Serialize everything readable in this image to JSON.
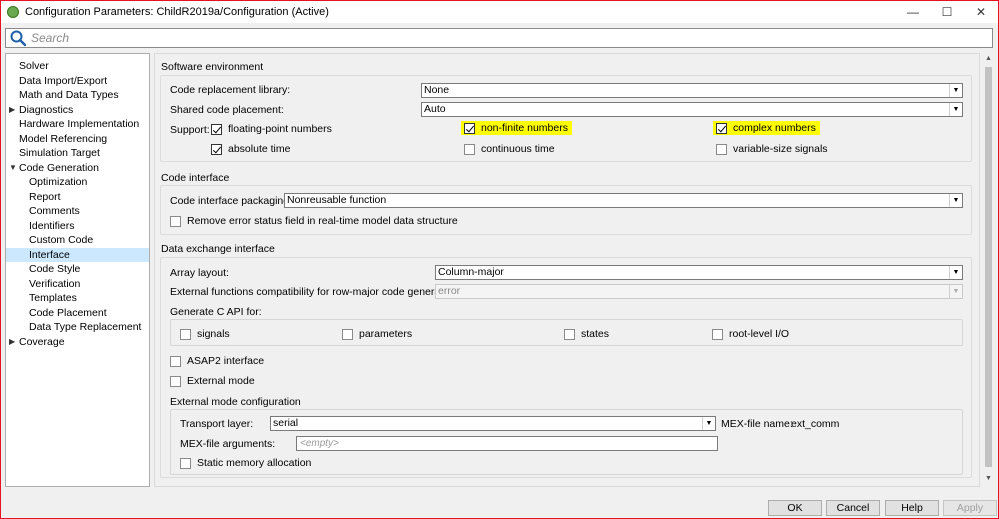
{
  "window": {
    "title": "Configuration Parameters: ChildR2019a/Configuration (Active)",
    "controls": {
      "minimize": "—",
      "maximize": "☐",
      "close": "✕"
    }
  },
  "search": {
    "placeholder": "Search"
  },
  "nav": {
    "items": [
      {
        "label": "Solver",
        "expandable": false,
        "child": false,
        "selected": false
      },
      {
        "label": "Data Import/Export",
        "expandable": false,
        "child": false,
        "selected": false
      },
      {
        "label": "Math and Data Types",
        "expandable": false,
        "child": false,
        "selected": false
      },
      {
        "label": "Diagnostics",
        "expandable": true,
        "expanded": false,
        "child": false,
        "selected": false
      },
      {
        "label": "Hardware Implementation",
        "expandable": false,
        "child": false,
        "selected": false
      },
      {
        "label": "Model Referencing",
        "expandable": false,
        "child": false,
        "selected": false
      },
      {
        "label": "Simulation Target",
        "expandable": false,
        "child": false,
        "selected": false
      },
      {
        "label": "Code Generation",
        "expandable": true,
        "expanded": true,
        "child": false,
        "selected": false
      },
      {
        "label": "Optimization",
        "expandable": false,
        "child": true,
        "selected": false
      },
      {
        "label": "Report",
        "expandable": false,
        "child": true,
        "selected": false
      },
      {
        "label": "Comments",
        "expandable": false,
        "child": true,
        "selected": false
      },
      {
        "label": "Identifiers",
        "expandable": false,
        "child": true,
        "selected": false
      },
      {
        "label": "Custom Code",
        "expandable": false,
        "child": true,
        "selected": false
      },
      {
        "label": "Interface",
        "expandable": false,
        "child": true,
        "selected": true
      },
      {
        "label": "Code Style",
        "expandable": false,
        "child": true,
        "selected": false
      },
      {
        "label": "Verification",
        "expandable": false,
        "child": true,
        "selected": false
      },
      {
        "label": "Templates",
        "expandable": false,
        "child": true,
        "selected": false
      },
      {
        "label": "Code Placement",
        "expandable": false,
        "child": true,
        "selected": false
      },
      {
        "label": "Data Type Replacement",
        "expandable": false,
        "child": true,
        "selected": false
      },
      {
        "label": "Coverage",
        "expandable": true,
        "expanded": false,
        "child": false,
        "selected": false
      }
    ]
  },
  "software_env": {
    "title": "Software environment",
    "code_replacement_label": "Code replacement library:",
    "code_replacement_value": "None",
    "shared_code_label": "Shared code placement:",
    "shared_code_value": "Auto",
    "support_label": "Support:",
    "floating_point": {
      "label": "floating-point numbers",
      "checked": true
    },
    "non_finite": {
      "label": "non-finite numbers",
      "checked": true,
      "highlighted": true
    },
    "complex": {
      "label": "complex numbers",
      "checked": true,
      "highlighted": true
    },
    "absolute_time": {
      "label": "absolute time",
      "checked": true
    },
    "continuous_time": {
      "label": "continuous time",
      "checked": false
    },
    "variable_size": {
      "label": "variable-size signals",
      "checked": false
    }
  },
  "code_interface": {
    "title": "Code interface",
    "packaging_label": "Code interface packaging:",
    "packaging_value": "Nonreusable function",
    "remove_error_status": {
      "label": "Remove error status field in real-time model data structure",
      "checked": false
    }
  },
  "data_exchange": {
    "title": "Data exchange interface",
    "array_layout_label": "Array layout:",
    "array_layout_value": "Column-major",
    "ext_functions_label": "External functions compatibility for row-major code generation:",
    "ext_functions_value": "error",
    "c_api_label": "Generate C API for:",
    "c_api": [
      {
        "label": "signals",
        "checked": false
      },
      {
        "label": "parameters",
        "checked": false
      },
      {
        "label": "states",
        "checked": false
      },
      {
        "label": "root-level I/O",
        "checked": false
      }
    ],
    "asap2": {
      "label": "ASAP2 interface",
      "checked": false
    },
    "external_mode": {
      "label": "External mode",
      "checked": false
    },
    "ext_mode_config_title": "External mode configuration",
    "transport_label": "Transport layer:",
    "transport_value": "serial",
    "mex_name_label": "MEX-file name:",
    "mex_name_value": "ext_comm",
    "mex_args_label": "MEX-file arguments:",
    "mex_args_placeholder": "<empty>",
    "static_memory": {
      "label": "Static memory allocation",
      "checked": false
    }
  },
  "buttons": {
    "ok": "OK",
    "cancel": "Cancel",
    "help": "Help",
    "apply": "Apply"
  },
  "colors": {
    "highlight": "#ffff00",
    "selected_nav": "#cce8ff",
    "window_border": "#e81123"
  }
}
